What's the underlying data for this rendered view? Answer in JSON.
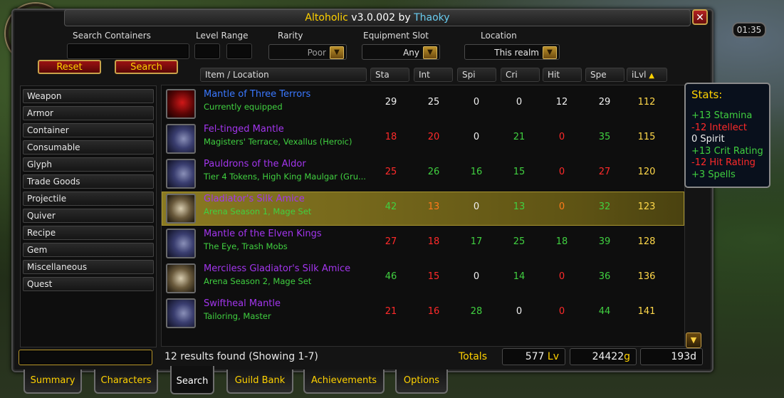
{
  "clock": "01:35",
  "title": {
    "app": "Altoholic",
    "version": " v3.0.002 by ",
    "author": "Thaoky"
  },
  "search": {
    "containers_label": "Search Containers",
    "level_range_label": "Level Range",
    "rarity_label": "Rarity",
    "rarity_value": "Poor",
    "slot_label": "Equipment Slot",
    "slot_value": "Any",
    "location_label": "Location",
    "location_value": "This realm",
    "reset_label": "Reset",
    "search_label": "Search"
  },
  "columns": [
    "Item / Location",
    "Sta",
    "Int",
    "Spi",
    "Cri",
    "Hit",
    "Spe",
    "iLvl"
  ],
  "categories": [
    "Weapon",
    "Armor",
    "Container",
    "Consumable",
    "Glyph",
    "Trade Goods",
    "Projectile",
    "Quiver",
    "Recipe",
    "Gem",
    "Miscellaneous",
    "Quest"
  ],
  "items": [
    {
      "name": "Mantle of Three Terrors",
      "location": "Currently equipped",
      "icon": "red-shoulder-icon",
      "quality_color": "#3a78ff",
      "stats": [
        {
          "v": "29",
          "c": "w"
        },
        {
          "v": "25",
          "c": "w"
        },
        {
          "v": "0",
          "c": "w"
        },
        {
          "v": "0",
          "c": "w"
        },
        {
          "v": "12",
          "c": "w"
        },
        {
          "v": "29",
          "c": "w"
        }
      ],
      "ilvl": "112"
    },
    {
      "name": "Fel-tinged Mantle",
      "location": "Magisters' Terrace, Vexallus (Heroic)",
      "icon": "blue-shoulder-icon",
      "quality_color": "#a335ee",
      "stats": [
        {
          "v": "18",
          "c": "r"
        },
        {
          "v": "20",
          "c": "r"
        },
        {
          "v": "0",
          "c": "w"
        },
        {
          "v": "21",
          "c": "g"
        },
        {
          "v": "0",
          "c": "r"
        },
        {
          "v": "35",
          "c": "g"
        }
      ],
      "ilvl": "115"
    },
    {
      "name": "Pauldrons of the Aldor",
      "location": "Tier 4 Tokens, High King Maulgar (Gru...",
      "icon": "blue-shoulder-icon",
      "quality_color": "#a335ee",
      "stats": [
        {
          "v": "25",
          "c": "r"
        },
        {
          "v": "26",
          "c": "g"
        },
        {
          "v": "16",
          "c": "g"
        },
        {
          "v": "15",
          "c": "g"
        },
        {
          "v": "0",
          "c": "r"
        },
        {
          "v": "27",
          "c": "r"
        }
      ],
      "ilvl": "120"
    },
    {
      "name": "Gladiator's Silk Amice",
      "location": "Arena Season 1, Mage Set",
      "icon": "bone-shoulder-icon",
      "quality_color": "#a335ee",
      "stats": [
        {
          "v": "42",
          "c": "g"
        },
        {
          "v": "13",
          "c": "o"
        },
        {
          "v": "0",
          "c": "w"
        },
        {
          "v": "13",
          "c": "g"
        },
        {
          "v": "0",
          "c": "o"
        },
        {
          "v": "32",
          "c": "g"
        }
      ],
      "ilvl": "123",
      "selected": true
    },
    {
      "name": "Mantle of the Elven Kings",
      "location": "The Eye, Trash Mobs",
      "icon": "blue-shoulder-icon",
      "quality_color": "#a335ee",
      "stats": [
        {
          "v": "27",
          "c": "r"
        },
        {
          "v": "18",
          "c": "r"
        },
        {
          "v": "17",
          "c": "g"
        },
        {
          "v": "25",
          "c": "g"
        },
        {
          "v": "18",
          "c": "g"
        },
        {
          "v": "39",
          "c": "g"
        }
      ],
      "ilvl": "128"
    },
    {
      "name": "Merciless Gladiator's Silk Amice",
      "location": "Arena Season 2, Mage Set",
      "icon": "bone-shoulder-icon",
      "quality_color": "#a335ee",
      "stats": [
        {
          "v": "46",
          "c": "g"
        },
        {
          "v": "15",
          "c": "r"
        },
        {
          "v": "0",
          "c": "w"
        },
        {
          "v": "14",
          "c": "g"
        },
        {
          "v": "0",
          "c": "r"
        },
        {
          "v": "36",
          "c": "g"
        }
      ],
      "ilvl": "136"
    },
    {
      "name": "Swiftheal Mantle",
      "location": "Tailoring, Master",
      "icon": "blue-shoulder-icon",
      "quality_color": "#a335ee",
      "stats": [
        {
          "v": "21",
          "c": "r"
        },
        {
          "v": "16",
          "c": "r"
        },
        {
          "v": "28",
          "c": "g"
        },
        {
          "v": "0",
          "c": "w"
        },
        {
          "v": "0",
          "c": "r"
        },
        {
          "v": "44",
          "c": "g"
        }
      ],
      "ilvl": "141"
    }
  ],
  "tooltip": {
    "title": "Stats:",
    "lines": [
      {
        "text": "+13 Stamina",
        "c": "g"
      },
      {
        "text": "-12 Intellect",
        "c": "r"
      },
      {
        "text": "0 Spirit",
        "c": "w"
      },
      {
        "text": "+13 Crit Rating",
        "c": "g"
      },
      {
        "text": "-12 Hit Rating",
        "c": "r"
      },
      {
        "text": "+3 Spells",
        "c": "g"
      }
    ]
  },
  "footer": {
    "results": "12 results found (Showing 1-7)",
    "totals_label": "Totals",
    "levels": "577",
    "levels_unit": " Lv",
    "gold": "24422",
    "gold_unit": "g",
    "days": "193d"
  },
  "tabs": [
    "Summary",
    "Characters",
    "Search",
    "Guild Bank",
    "Achievements",
    "Options"
  ],
  "active_tab": "Search"
}
